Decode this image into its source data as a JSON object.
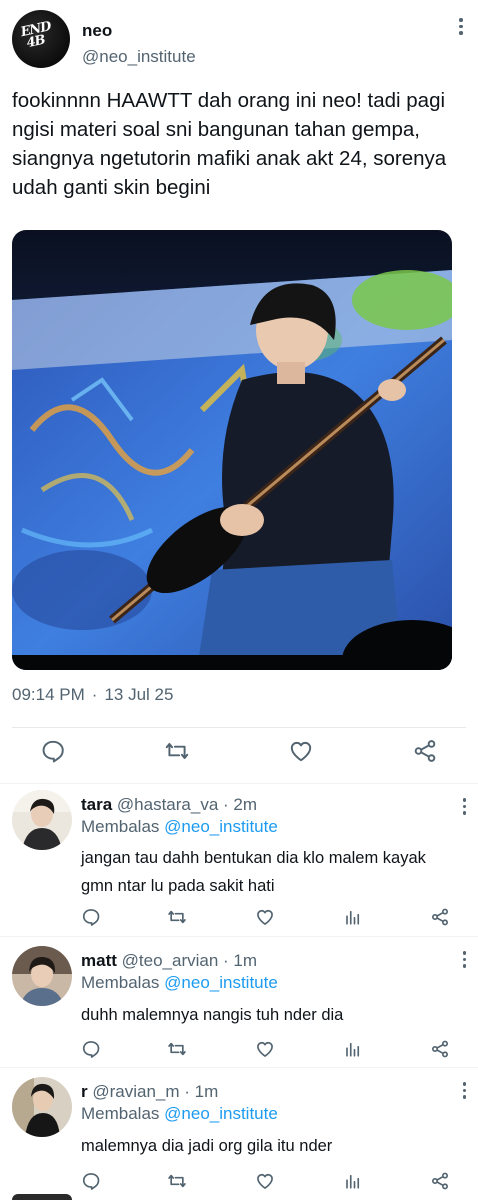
{
  "tweet": {
    "author_name": "neo",
    "author_handle": "@neo_institute",
    "avatar_text": "END 4B",
    "text": "fookinnnn HAAWTT dah orang ini neo! tadi pagi ngisi materi soal sni bangunan tahan gempa, siangnya ngetutorin mafiki anak akt 24, sorenya udah ganti skin begini",
    "time": "09:14 PM",
    "separator": "·",
    "date": "13 Jul 25",
    "media_description": "photo"
  },
  "actions": {
    "reply_icon": "reply-icon",
    "retweet_icon": "retweet-icon",
    "like_icon": "heart-icon",
    "share_icon": "share-icon",
    "views_icon": "views-icon"
  },
  "replies": [
    {
      "name": "tara",
      "handle": "@hastara_va",
      "time": "· 2m",
      "replying_prefix": "Membalas",
      "replying_to": "@neo_institute",
      "text": "jangan tau dahh bentukan dia klo malem kayak gmn ntar lu pada sakit hati"
    },
    {
      "name": "matt",
      "handle": "@teo_arvian",
      "time": "· 1m",
      "replying_prefix": "Membalas",
      "replying_to": "@neo_institute",
      "text": "duhh malemnya nangis tuh nder dia"
    },
    {
      "name": "r",
      "handle": "@ravian_m",
      "time": "· 1m",
      "replying_prefix": "Membalas",
      "replying_to": "@neo_institute",
      "text": "malemnya dia jadi org gila itu nder"
    }
  ],
  "colors": {
    "text": "#0f1419",
    "secondary": "#536471",
    "link": "#1d9bf0",
    "divider": "#eff3f4"
  }
}
